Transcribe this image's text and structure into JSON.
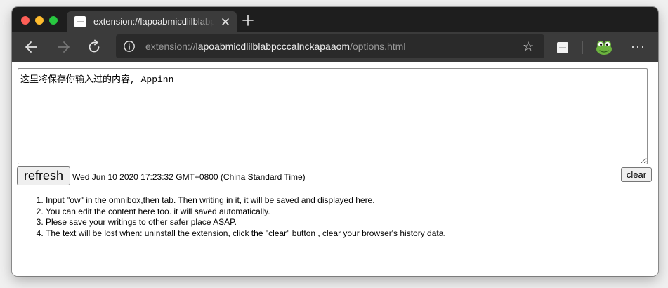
{
  "browser": {
    "tab": {
      "title": "extension://lapoabmicdlilblabpcccalnckapaaom/options.html"
    },
    "address_bar": {
      "scheme": "extension://",
      "host": "lapoabmicdlilblabpcccalnckapaaom",
      "path": "/options.html"
    },
    "icons": {
      "back": "back-arrow-icon",
      "forward": "forward-arrow-icon",
      "reload": "reload-icon",
      "site_info": "info-icon",
      "favorite": "star-icon",
      "extension": "extension-icon",
      "profile": "frog-avatar-icon",
      "menu": "more-icon"
    },
    "star_glyph": "☆",
    "menu_glyph": "···"
  },
  "page": {
    "editor": {
      "content": "这里将保存你输入过的内容, Appinn"
    },
    "refresh_label": "refresh",
    "timestamp": "Wed Jun 10 2020 17:23:32 GMT+0800 (China Standard Time)",
    "clear_label": "clear",
    "instructions": [
      "Input \"ow\" in the omnibox,then tab. Then writing in it, it will be saved and displayed here.",
      "You can edit the content here too. it will saved automatically.",
      "Plese save your writings to other safer place ASAP.",
      "The text will be lost when: uninstall the extension, click the \"clear\" button , clear your browser's history data."
    ]
  },
  "colors": {
    "tabbar": "#1e1e1e",
    "toolbar": "#3b3b3b",
    "omnibox": "#2a2a2a",
    "close": "#fe5f57",
    "minimize": "#febc2e",
    "maximize": "#28c840"
  }
}
